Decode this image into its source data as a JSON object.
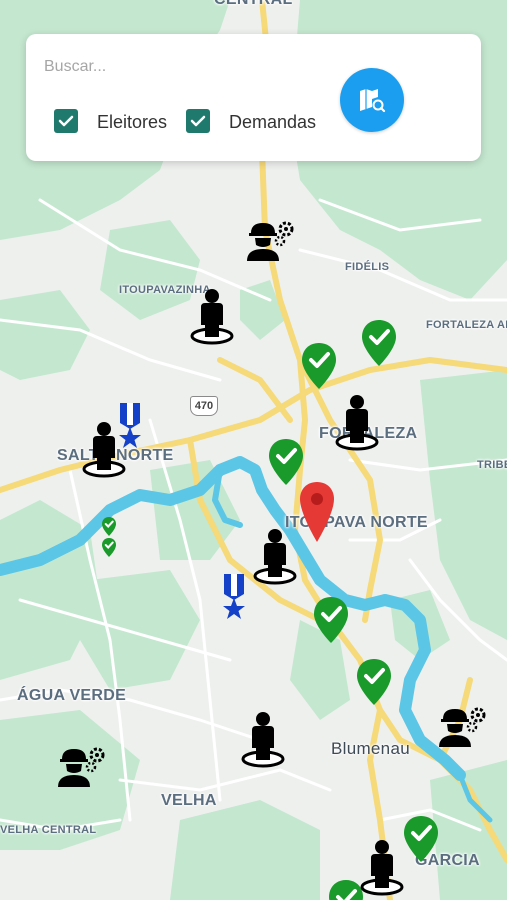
{
  "search": {
    "placeholder": "Buscar...",
    "value": ""
  },
  "filters": [
    {
      "label": "Eleitores",
      "checked": true
    },
    {
      "label": "Demandas",
      "checked": true
    }
  ],
  "search_button_icon": "map-search-icon",
  "map": {
    "labels": {
      "central_top": "CENTRAL",
      "fidelis": "FIDÉLIS",
      "itoupavazinha": "ITOUPAVAZINHA",
      "fortaleza_alta": "FORTALEZA ALT",
      "fortaleza": "FORTALEZA",
      "tribess": "TRIBE",
      "salto_norte": "SALTO NORTE",
      "itoupava_norte": "ITOUPAVA NORTE",
      "agua_verde": "ÁGUA VERDE",
      "blumenau": "Blumenau",
      "velha": "VELHA",
      "velha_central": "VELHA CENTRAL",
      "garcia": "GARCIA",
      "highway": "470"
    },
    "colors": {
      "land": "#eef0ee",
      "green_area": "#c4e7cf",
      "water": "#5cc6e6",
      "road_major": "#f6d978",
      "road_minor": "#ffffff",
      "demand_green": "#1a9a2a",
      "selected_red": "#e53935",
      "medal_blue": "#1540c8",
      "voter_black": "#000000"
    },
    "marker_icons": [
      "voter-person-icon",
      "demand-check-pin-icon",
      "worker-gear-icon",
      "medal-star-icon",
      "selected-location-pin-icon"
    ]
  }
}
